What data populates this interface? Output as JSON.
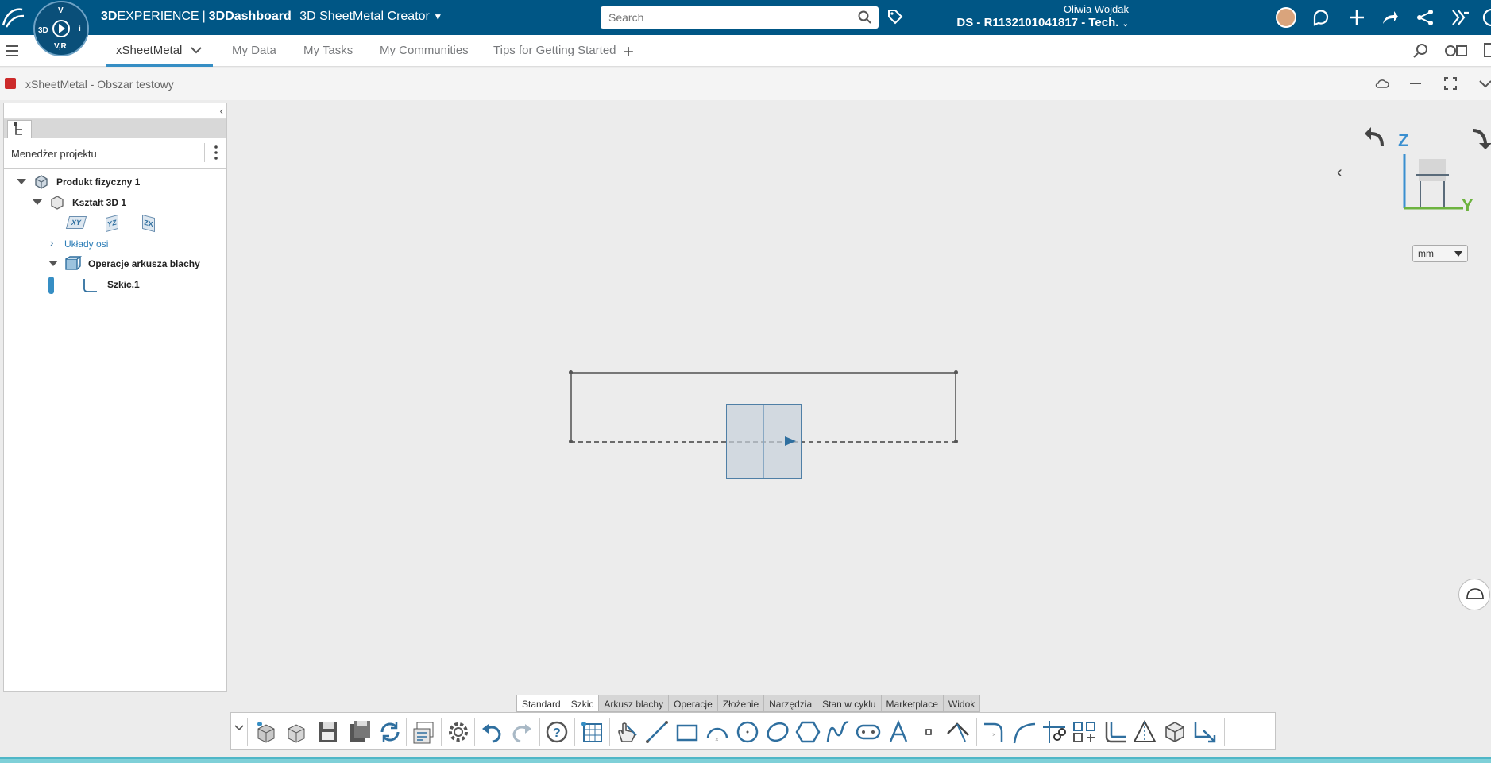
{
  "topbar": {
    "brand": "3D",
    "brand_light": "EXPERIENCE",
    "separator": "|",
    "dashboard": "3DDashboard",
    "app_name": "3D SheetMetal Creator",
    "search_placeholder": "Search",
    "user_name": "Oliwia Wojdak",
    "tenant": "DS - R1132101041817 - Tech.",
    "compass": {
      "north": "V",
      "west": "3D",
      "east": "i",
      "south": "V,R"
    }
  },
  "tabs": [
    "xSheetMetal",
    "My Data",
    "My Tasks",
    "My Communities",
    "Tips for Getting Started"
  ],
  "widget": {
    "title": "xSheetMetal - Obszar testowy"
  },
  "panel": {
    "manager_label": "Menedżer projektu",
    "tree": {
      "physical_product": "Produkt fizyczny 1",
      "shape": "Kształt 3D 1",
      "planes": [
        "XY",
        "YZ",
        "ZX"
      ],
      "axis_systems": "Układy osi",
      "operations": "Operacje arkusza blachy",
      "sketch": "Szkic.1"
    }
  },
  "viewport": {
    "axis_z": "Z",
    "axis_y": "Y",
    "unit": "mm"
  },
  "action_tabs": [
    "Standard",
    "Szkic",
    "Arkusz blachy",
    "Operacje",
    "Złożenie",
    "Narzędzia",
    "Stan w cyklu",
    "Marketplace",
    "Widok"
  ],
  "colors": {
    "topbar": "#005685",
    "accent": "#368ec4",
    "sketch_blue": "#2f6f9f"
  }
}
